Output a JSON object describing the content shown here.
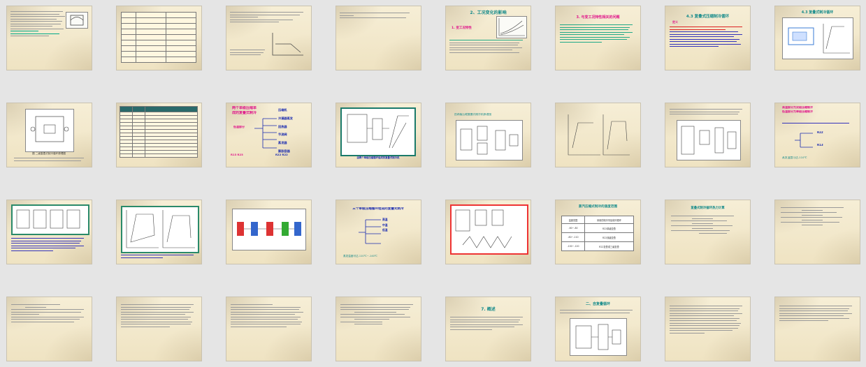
{
  "view": "slide-sorter",
  "slides": [
    {
      "n": 1,
      "title": ""
    },
    {
      "n": 2,
      "title": "",
      "table": {
        "headers": [
          "",
          "",
          ""
        ],
        "rows": []
      }
    },
    {
      "n": 3,
      "title": ""
    },
    {
      "n": 4,
      "title": ""
    },
    {
      "n": 5,
      "title": "2、工况变化的影响",
      "subtitle": "1. 变工况特性"
    },
    {
      "n": 6,
      "title": "3. 与变工况特性相关的问题"
    },
    {
      "n": 7,
      "title": "4.3  复叠式压缩制冷循环",
      "sub": "定义"
    },
    {
      "n": 8,
      "title": "4.3  复叠式制冷循环"
    },
    {
      "n": 9,
      "title": "",
      "caption": "图    二级复叠式制冷循环原理图"
    },
    {
      "n": 10,
      "title": ""
    },
    {
      "n": 11,
      "title": "两个单级压缩单",
      "title2": "成的复叠式制冷",
      "items": [
        "压缩机",
        "冷凝器蒸发",
        "回热器",
        "节流阀",
        "蒸发器",
        "膨胀容器"
      ],
      "left_label": "低温部分",
      "bottom_left": "R13 R23",
      "bottom_right": "R22 R22"
    },
    {
      "n": 12,
      "title": "",
      "caption": "由两个单级压缩循环组成的复叠式制冷机"
    },
    {
      "n": 13,
      "title": "由两级压缩复叠式制冷机原理图"
    },
    {
      "n": 14,
      "title": ""
    },
    {
      "n": 15,
      "title": "",
      "lines": [
        "高温部分为双级压缩制冷",
        "低温部分为单级压缩制冷"
      ],
      "items": [
        "R22",
        "R13"
      ],
      "footer": "蒸发温度可达-110℃"
    },
    {
      "n": 16,
      "title": ""
    },
    {
      "n": 17,
      "title": ""
    },
    {
      "n": 18,
      "title": ""
    },
    {
      "n": 19,
      "title": "三个单级压缩循环组成的复叠式制冷",
      "items": [
        "高温",
        "中温",
        "低温"
      ],
      "footer": "蒸发温度可达-110℃~-140℃"
    },
    {
      "n": 20,
      "title": ""
    },
    {
      "n": 21,
      "title": "蒸汽压缩式制冷的温度范围",
      "table": {
        "headers": [
          "温度范围",
          "采用的制冷剂及制冷循环"
        ],
        "rows": [
          [
            "-60~-80",
            "R22单级复叠"
          ],
          [
            "-80~-110",
            "R22双级复叠"
          ],
          [
            "-100~-120",
            "R22复叠或三级复叠"
          ]
        ]
      }
    },
    {
      "n": 22,
      "title": "复叠式制冷循环热力计算"
    },
    {
      "n": 23,
      "title": ""
    },
    {
      "n": 24,
      "title": ""
    },
    {
      "n": 25,
      "title": ""
    },
    {
      "n": 26,
      "title": ""
    },
    {
      "n": 27,
      "title": ""
    },
    {
      "n": 28,
      "title": ""
    },
    {
      "n": 29,
      "title": "7.  概述"
    },
    {
      "n": 30,
      "title": "二、自复叠循环"
    },
    {
      "n": 31,
      "title": ""
    },
    {
      "n": 32,
      "title": ""
    }
  ]
}
